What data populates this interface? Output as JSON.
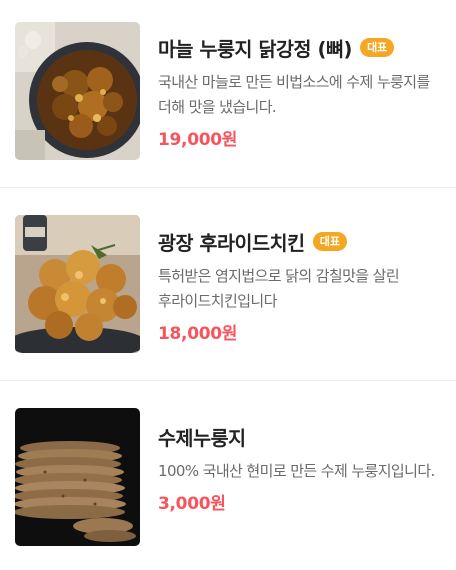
{
  "menu": {
    "items": [
      {
        "name": "마늘 누룽지 닭강정 (뼈)",
        "badge": "대표",
        "description": "국내산 마늘로 만든 비법소스에 수제 누룽지를 더해 맛을 냈습니다.",
        "price": "19,000원",
        "image_icon": "garlic-fried-chicken-photo"
      },
      {
        "name": "광장 후라이드치킨",
        "badge": "대표",
        "description": "특허받은 염지법으로 닭의 감칠맛을 살린 후라이드치킨입니다",
        "price": "18,000원",
        "image_icon": "fried-chicken-photo"
      },
      {
        "name": "수제누룽지",
        "badge": "",
        "description": "100% 국내산 현미로 만든 수제 누룽지입니다.",
        "price": "3,000원",
        "image_icon": "nurungji-photo"
      }
    ]
  },
  "colors": {
    "badge": "#f5a623",
    "price": "#f7545d",
    "title": "#222222",
    "description": "#6b6b6b",
    "divider": "#ececec"
  }
}
